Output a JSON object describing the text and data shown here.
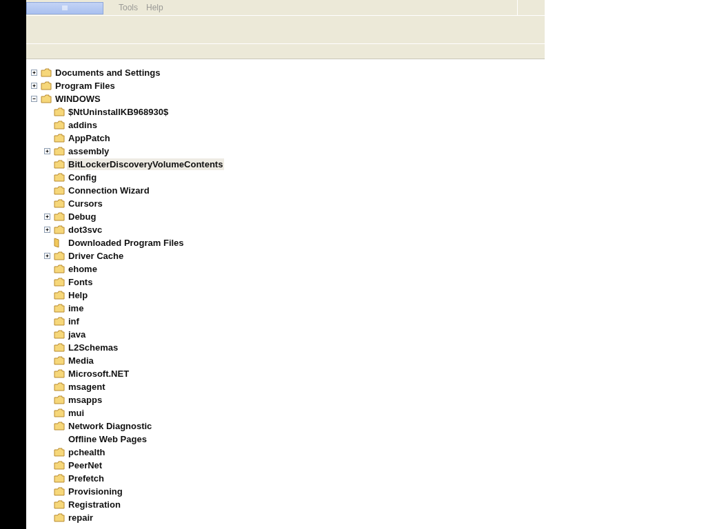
{
  "menu_bar": {
    "items": [
      {
        "label": "Tools"
      },
      {
        "label": "Help"
      }
    ]
  },
  "tree": [
    {
      "label": "Documents and Settings",
      "kind": "folder",
      "expanded": false,
      "selected": false
    },
    {
      "label": "Program Files",
      "kind": "folder",
      "expanded": false,
      "selected": false
    },
    {
      "label": "WINDOWS",
      "kind": "folder",
      "expanded": true,
      "selected": false,
      "children": [
        {
          "label": "$NtUninstallKB968930$",
          "kind": "folder",
          "selected": false
        },
        {
          "label": "addins",
          "kind": "folder",
          "selected": false
        },
        {
          "label": "AppPatch",
          "kind": "folder",
          "selected": false
        },
        {
          "label": "assembly",
          "kind": "folder",
          "expanded": false,
          "selected": false
        },
        {
          "label": "BitLockerDiscoveryVolumeContents",
          "kind": "folder",
          "selected": true
        },
        {
          "label": "Config",
          "kind": "folder",
          "selected": false
        },
        {
          "label": "Connection Wizard",
          "kind": "folder",
          "selected": false
        },
        {
          "label": "Cursors",
          "kind": "folder",
          "selected": false
        },
        {
          "label": "Debug",
          "kind": "folder",
          "expanded": false,
          "selected": false
        },
        {
          "label": "dot3svc",
          "kind": "folder",
          "expanded": false,
          "selected": false
        },
        {
          "label": "Downloaded Program Files",
          "kind": "special",
          "selected": false
        },
        {
          "label": "Driver Cache",
          "kind": "folder",
          "expanded": false,
          "selected": false
        },
        {
          "label": "ehome",
          "kind": "folder",
          "selected": false
        },
        {
          "label": "Fonts",
          "kind": "folder",
          "selected": false
        },
        {
          "label": "Help",
          "kind": "folder",
          "selected": false
        },
        {
          "label": "ime",
          "kind": "folder",
          "selected": false
        },
        {
          "label": "inf",
          "kind": "folder",
          "selected": false
        },
        {
          "label": "java",
          "kind": "folder",
          "selected": false
        },
        {
          "label": "L2Schemas",
          "kind": "folder",
          "selected": false
        },
        {
          "label": "Media",
          "kind": "folder",
          "selected": false
        },
        {
          "label": "Microsoft.NET",
          "kind": "folder",
          "selected": false
        },
        {
          "label": "msagent",
          "kind": "folder",
          "selected": false
        },
        {
          "label": "msapps",
          "kind": "folder",
          "selected": false
        },
        {
          "label": "mui",
          "kind": "folder",
          "selected": false
        },
        {
          "label": "Network Diagnostic",
          "kind": "folder",
          "selected": false
        },
        {
          "label": "Offline Web Pages",
          "kind": "none",
          "selected": false
        },
        {
          "label": "pchealth",
          "kind": "folder",
          "selected": false
        },
        {
          "label": "PeerNet",
          "kind": "folder",
          "selected": false
        },
        {
          "label": "Prefetch",
          "kind": "folder",
          "selected": false
        },
        {
          "label": "Provisioning",
          "kind": "folder",
          "selected": false
        },
        {
          "label": "Registration",
          "kind": "folder",
          "selected": false
        },
        {
          "label": "repair",
          "kind": "folder",
          "selected": false
        }
      ]
    }
  ]
}
